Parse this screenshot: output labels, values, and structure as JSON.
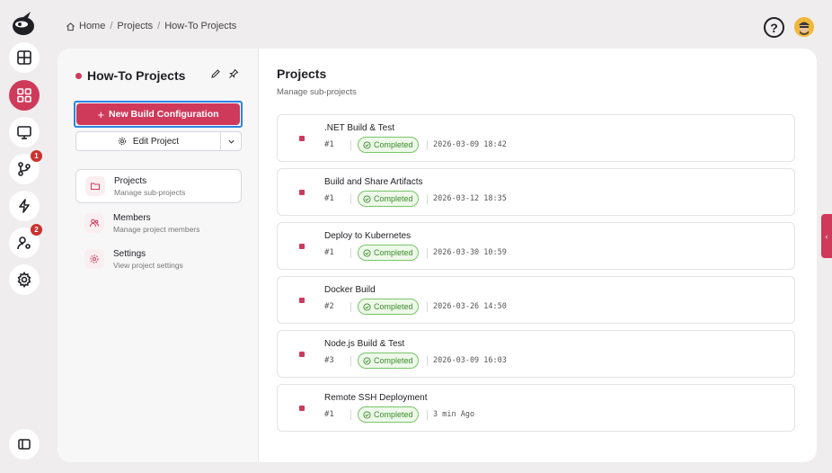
{
  "breadcrumb": {
    "home": "Home",
    "projects": "Projects",
    "current": "How-To Projects",
    "sep": "/"
  },
  "header": {
    "help_glyph": "?"
  },
  "rail": {
    "items": [
      {
        "icon": "dashboard-icon"
      },
      {
        "icon": "grid-icon",
        "active": true
      },
      {
        "icon": "monitor-icon"
      },
      {
        "icon": "git-branch-icon",
        "badge": "1"
      },
      {
        "icon": "bolt-icon"
      },
      {
        "icon": "user-settings-icon",
        "badge": "2"
      },
      {
        "icon": "gear-icon"
      }
    ],
    "collapse_icon": "sidebar-toggle-icon"
  },
  "side": {
    "title": "How-To Projects",
    "new_build": "New Build Configuration",
    "edit_project": "Edit Project",
    "nav": [
      {
        "title": "Projects",
        "subtitle": "Manage sub-projects"
      },
      {
        "title": "Members",
        "subtitle": "Manage project members"
      },
      {
        "title": "Settings",
        "subtitle": "View project settings"
      }
    ]
  },
  "content": {
    "title": "Projects",
    "subtitle": "Manage sub-projects",
    "rows": [
      {
        "name": ".NET Build & Test",
        "num": "#1",
        "status": "Completed",
        "time": "2026-03-09 18:42"
      },
      {
        "name": "Build and Share Artifacts",
        "num": "#1",
        "status": "Completed",
        "time": "2026-03-12 18:35"
      },
      {
        "name": "Deploy to Kubernetes",
        "num": "#1",
        "status": "Completed",
        "time": "2026-03-30 10:59"
      },
      {
        "name": "Docker Build",
        "num": "#2",
        "status": "Completed",
        "time": "2026-03-26 14:50"
      },
      {
        "name": "Node.js Build & Test",
        "num": "#3",
        "status": "Completed",
        "time": "2026-03-09 16:03"
      },
      {
        "name": "Remote SSH Deployment",
        "num": "#1",
        "status": "Completed",
        "time": "3 min Ago"
      }
    ]
  },
  "colors": {
    "accent": "#cf3a5b",
    "success": "#3a8c2a",
    "focus": "#2b86e0"
  }
}
